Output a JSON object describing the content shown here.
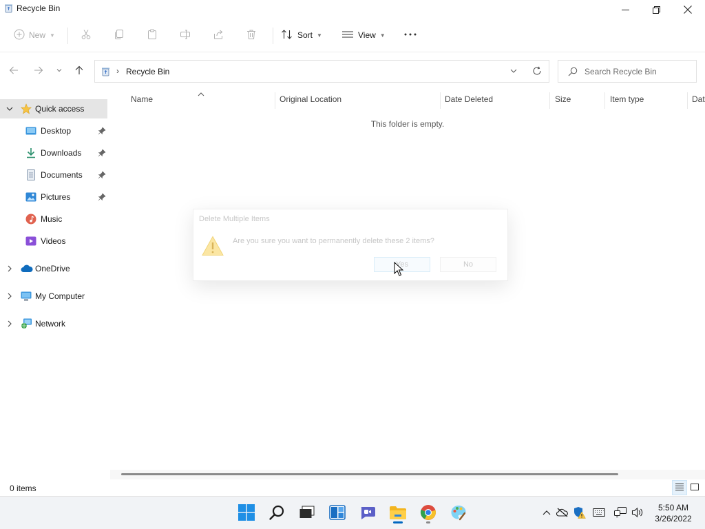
{
  "window": {
    "title": "Recycle Bin",
    "icons": {
      "app": "recycle-bin-icon",
      "minimize": "minimize-icon",
      "maximize": "restore-icon",
      "close": "close-icon"
    }
  },
  "command_bar": {
    "new_label": "New",
    "sort_label": "Sort",
    "view_label": "View",
    "icons": [
      "new-icon",
      "cut-icon",
      "copy-icon",
      "paste-icon",
      "rename-icon",
      "share-icon",
      "delete-icon",
      "sort-icon",
      "view-icon",
      "more-icon"
    ]
  },
  "address_bar": {
    "path": "Recycle Bin",
    "search_placeholder": "Search Recycle Bin"
  },
  "sidebar": {
    "items": [
      {
        "label": "Quick access",
        "icon": "star-icon",
        "selected": true,
        "expanded": true
      },
      {
        "label": "Desktop",
        "icon": "desktop-icon",
        "pinned": true
      },
      {
        "label": "Downloads",
        "icon": "downloads-icon",
        "pinned": true
      },
      {
        "label": "Documents",
        "icon": "documents-icon",
        "pinned": true
      },
      {
        "label": "Pictures",
        "icon": "pictures-icon",
        "pinned": true
      },
      {
        "label": "Music",
        "icon": "music-icon"
      },
      {
        "label": "Videos",
        "icon": "videos-icon"
      },
      {
        "label": "OneDrive",
        "icon": "cloud-icon"
      },
      {
        "label": "My Computer",
        "icon": "computer-icon"
      },
      {
        "label": "Network",
        "icon": "network-icon"
      }
    ]
  },
  "content": {
    "columns": [
      "Name",
      "Original Location",
      "Date Deleted",
      "Size",
      "Item type",
      "Dat"
    ],
    "empty_message": "This folder is empty."
  },
  "status_bar": {
    "item_count": "0 items"
  },
  "dialog": {
    "title": "Delete Multiple Items",
    "message": "Are you sure you want to permanently delete these 2 items?",
    "yes_label": "Yes",
    "no_label": "No",
    "icon": "warning-icon"
  },
  "taskbar": {
    "apps": [
      "start-icon",
      "search-icon",
      "task-view-icon",
      "widgets-icon",
      "chat-icon",
      "file-explorer-icon",
      "chrome-icon",
      "paint-icon"
    ],
    "tray": [
      "chevron-up-icon",
      "onedrive-offline-icon",
      "security-warning-icon",
      "keyboard-icon",
      "network-icon",
      "volume-icon"
    ],
    "time": "5:50 AM",
    "date": "3/26/2022"
  },
  "colors": {
    "accent": "#0067c0",
    "selected_bg": "#e5e5e5",
    "taskbar_bg": "#f1f3f6"
  }
}
